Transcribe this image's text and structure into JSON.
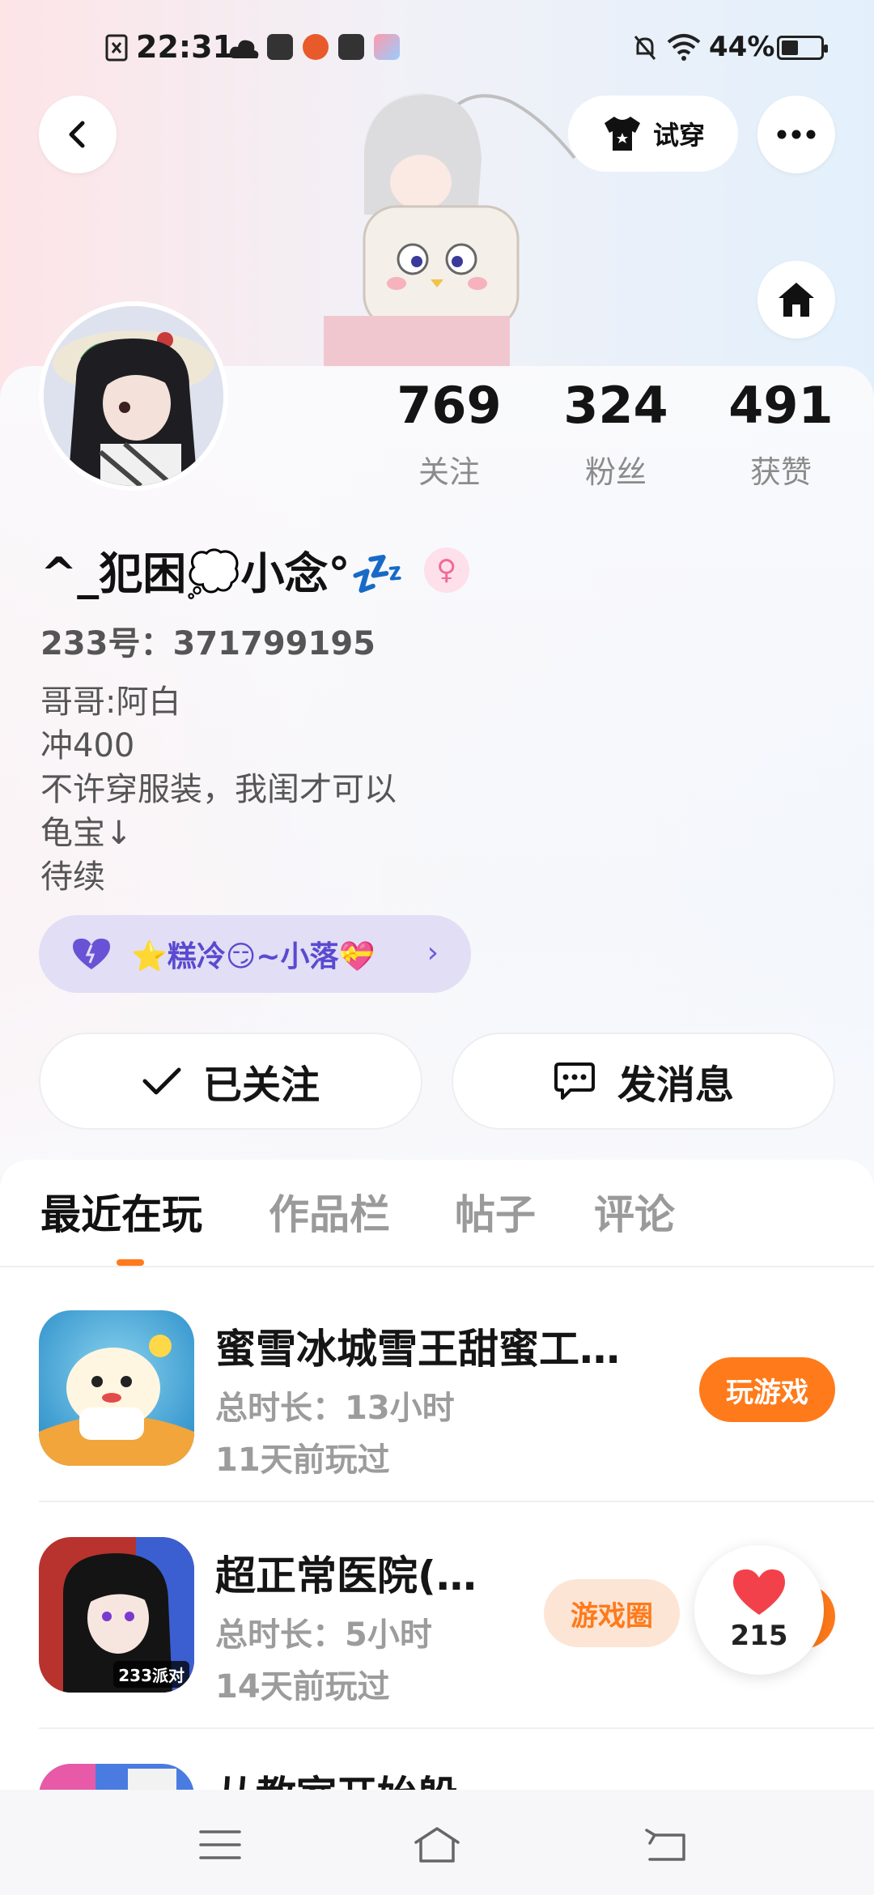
{
  "status_bar": {
    "time": "22:31",
    "battery_percent": "44%",
    "battery_level": 0.44
  },
  "header": {
    "tryon_label": "试穿"
  },
  "profile": {
    "stats": [
      {
        "value": "769",
        "label": "关注"
      },
      {
        "value": "324",
        "label": "粉丝"
      },
      {
        "value": "491",
        "label": "获赞"
      }
    ],
    "username": "^_犯困💭小念°💤",
    "uid": "233号：371799195",
    "bio": [
      "哥哥:阿白",
      "冲400",
      "不许穿服装，我闺才可以",
      "龟宝↓",
      "待续"
    ],
    "relation_tag": "⭐糕冷😏~小落💝",
    "followed_label": "已关注",
    "message_label": "发消息"
  },
  "tabs": [
    {
      "label": "最近在玩",
      "active": true
    },
    {
      "label": "作品栏",
      "active": false
    },
    {
      "label": "帖子",
      "active": false
    },
    {
      "label": "评论",
      "active": false
    }
  ],
  "games": [
    {
      "title": "蜜雪冰城雪王甜蜜工…",
      "duration": "总时长：13小时",
      "last_played": "11天前玩过",
      "button": "玩游戏"
    },
    {
      "title": "超正常医院(…",
      "duration": "总时长：5小时",
      "last_played": "14天前玩过",
      "secondary_button": "游戏圈",
      "icon_tag": "233派对"
    },
    {
      "title": "从教室开始躲…"
    }
  ],
  "like_float": {
    "count": "215"
  },
  "colors": {
    "accent": "#ff7a1a",
    "relation_tag_bg": "#e2def5",
    "relation_tag_text": "#5a4ad0"
  }
}
